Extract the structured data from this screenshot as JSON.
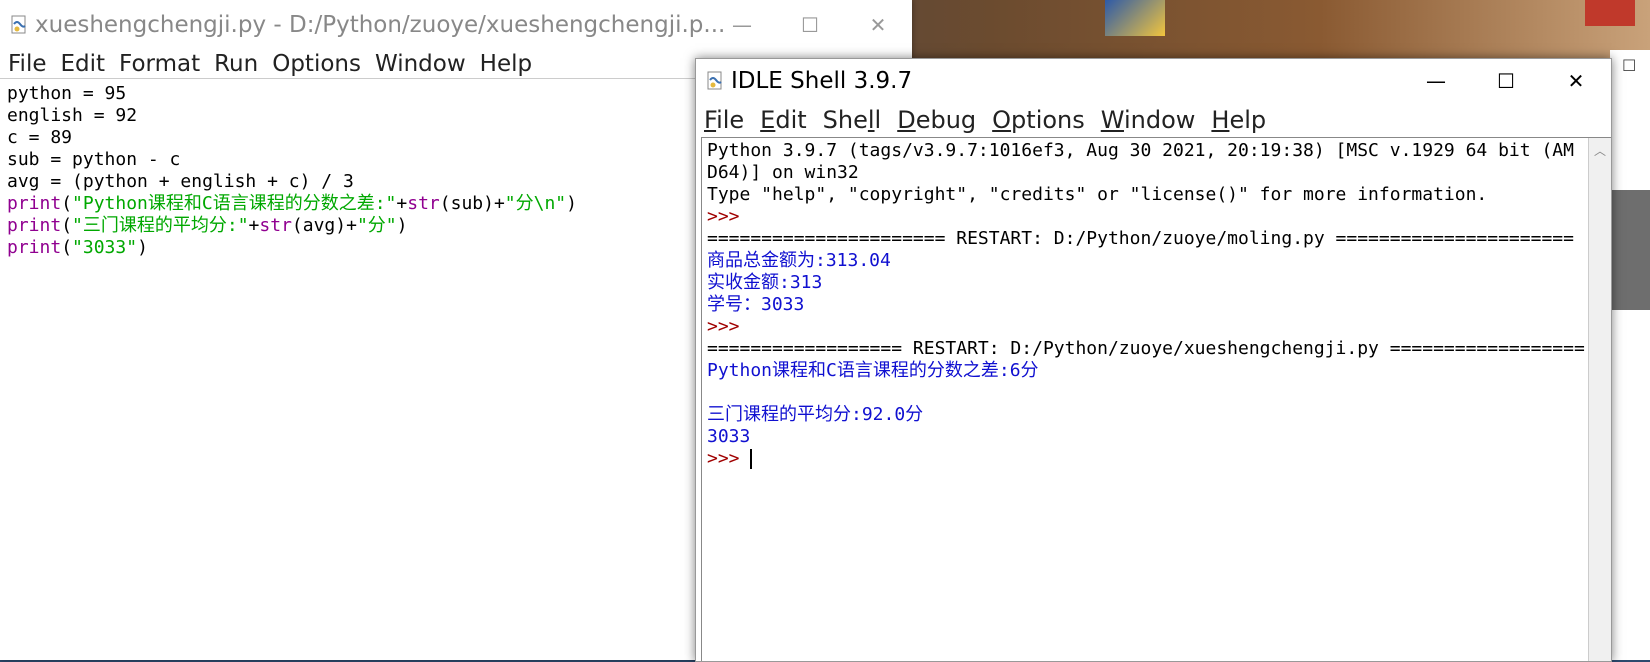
{
  "editor": {
    "title": "xueshengchengji.py - D:/Python/zuoye/xueshengchengji.p...",
    "menu": [
      "File",
      "Edit",
      "Format",
      "Run",
      "Options",
      "Window",
      "Help"
    ],
    "code_lines": [
      [
        {
          "t": "python = 95",
          "c": "plain"
        }
      ],
      [
        {
          "t": "english = 92",
          "c": "plain"
        }
      ],
      [
        {
          "t": "c = 89",
          "c": "plain"
        }
      ],
      [
        {
          "t": "sub = python - c",
          "c": "plain"
        }
      ],
      [
        {
          "t": "avg = (python + english + c) / 3",
          "c": "plain"
        }
      ],
      [
        {
          "t": "print",
          "c": "kw"
        },
        {
          "t": "(",
          "c": "plain"
        },
        {
          "t": "\"Python课程和C语言课程的分数之差:\"",
          "c": "str"
        },
        {
          "t": "+",
          "c": "plain"
        },
        {
          "t": "str",
          "c": "kw"
        },
        {
          "t": "(sub)+",
          "c": "plain"
        },
        {
          "t": "\"分\\n\"",
          "c": "str"
        },
        {
          "t": ")",
          "c": "plain"
        }
      ],
      [
        {
          "t": "print",
          "c": "kw"
        },
        {
          "t": "(",
          "c": "plain"
        },
        {
          "t": "\"三门课程的平均分:\"",
          "c": "str"
        },
        {
          "t": "+",
          "c": "plain"
        },
        {
          "t": "str",
          "c": "kw"
        },
        {
          "t": "(avg)+",
          "c": "plain"
        },
        {
          "t": "\"分\"",
          "c": "str"
        },
        {
          "t": ")",
          "c": "plain"
        }
      ],
      [
        {
          "t": "print",
          "c": "kw"
        },
        {
          "t": "(",
          "c": "plain"
        },
        {
          "t": "\"3033\"",
          "c": "str"
        },
        {
          "t": ")",
          "c": "plain"
        }
      ]
    ]
  },
  "shell": {
    "title": "IDLE Shell 3.9.7",
    "menu": [
      {
        "label": "File",
        "u": "F"
      },
      {
        "label": "Edit",
        "u": "E"
      },
      {
        "label": "Shell",
        "u": "l"
      },
      {
        "label": "Debug",
        "u": "D"
      },
      {
        "label": "Options",
        "u": "O"
      },
      {
        "label": "Window",
        "u": "W"
      },
      {
        "label": "Help",
        "u": "H"
      }
    ],
    "lines": [
      {
        "t": "Python 3.9.7 (tags/v3.9.7:1016ef3, Aug 30 2021, 20:19:38) [MSC v.1929 64 bit (AM",
        "c": "plain"
      },
      {
        "t": "D64)] on win32",
        "c": "plain"
      },
      {
        "t": "Type \"help\", \"copyright\", \"credits\" or \"license()\" for more information.",
        "c": "plain"
      },
      {
        "t": ">>> ",
        "c": "prompt"
      },
      {
        "t": "====================== RESTART: D:/Python/zuoye/moling.py ======================",
        "c": "plain"
      },
      {
        "t": "商品总金额为:313.04",
        "c": "out"
      },
      {
        "t": "实收金额:313",
        "c": "out"
      },
      {
        "t": "学号：3033",
        "c": "out"
      },
      {
        "t": ">>> ",
        "c": "prompt"
      },
      {
        "t": "================== RESTART: D:/Python/zuoye/xueshengchengji.py ==================",
        "c": "plain"
      },
      {
        "t": "Python课程和C语言课程的分数之差:6分",
        "c": "out"
      },
      {
        "t": "",
        "c": "out"
      },
      {
        "t": "三门课程的平均分:92.0分",
        "c": "out"
      },
      {
        "t": "3033",
        "c": "out"
      },
      {
        "t": ">>> ",
        "c": "prompt",
        "cursor": true
      }
    ]
  },
  "icons": {
    "editor_app": "idle-file-icon",
    "shell_app": "idle-file-icon",
    "minimize": "minimize-icon",
    "maximize": "maximize-icon",
    "close": "close-icon"
  },
  "colors": {
    "keyword": "#900090",
    "string": "#00a800",
    "output": "#1010d0",
    "prompt": "#a00000"
  }
}
